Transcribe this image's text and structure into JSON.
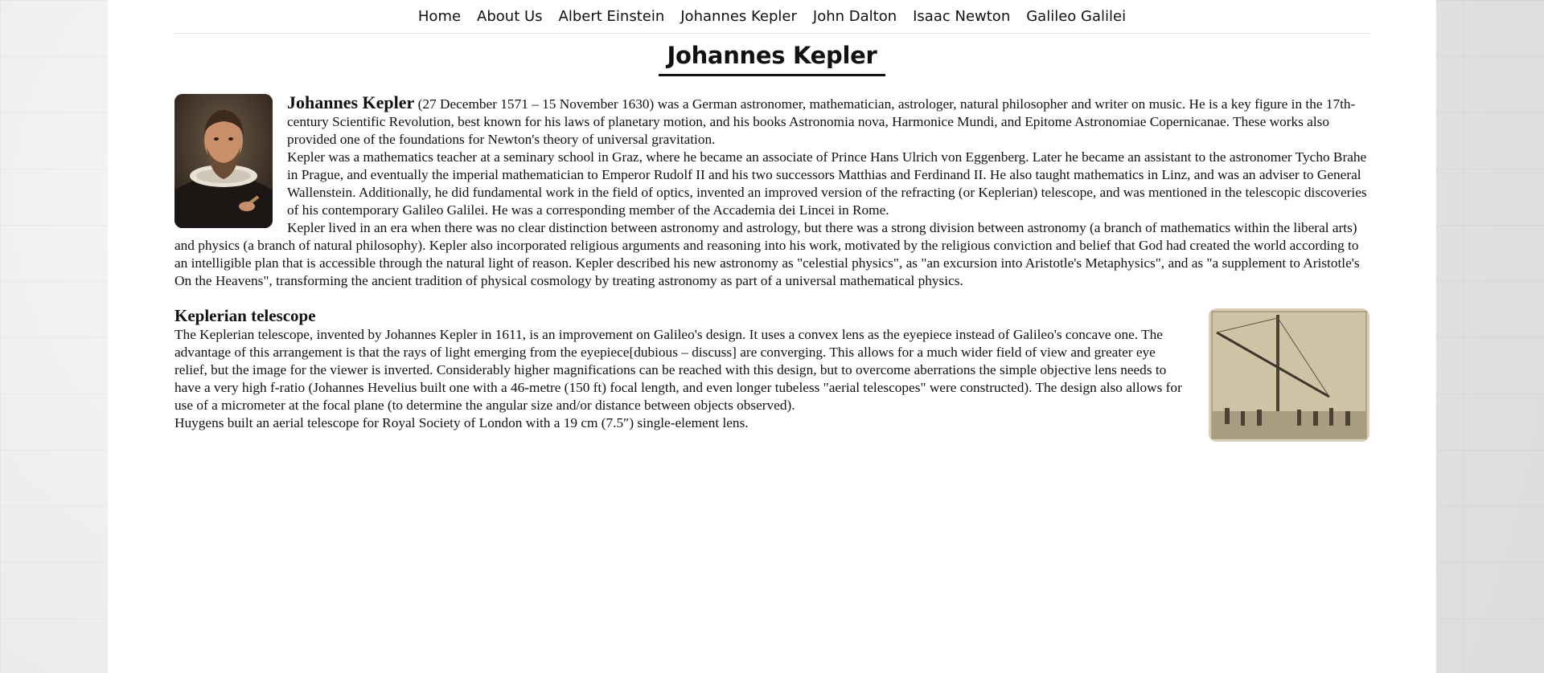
{
  "nav": {
    "items": [
      "Home",
      "About Us",
      "Albert Einstein",
      "Johannes Kepler",
      "John Dalton",
      "Isaac Newton",
      "Galileo Galilei"
    ]
  },
  "page": {
    "title": "Johannes Kepler"
  },
  "intro": {
    "lead_name": "Johannes Kepler",
    "lead_rest": " (27 December 1571 – 15 November 1630) was a German astronomer, mathematician, astrologer, natural philosopher and writer on music. He is a key figure in the 17th-century Scientific Revolution, best known for his laws of planetary motion, and his books Astronomia nova, Harmonice Mundi, and Epitome Astronomiae Copernicanae. These works also provided one of the foundations for Newton's theory of universal gravitation.",
    "p2": "Kepler was a mathematics teacher at a seminary school in Graz, where he became an associate of Prince Hans Ulrich von Eggenberg. Later he became an assistant to the astronomer Tycho Brahe in Prague, and eventually the imperial mathematician to Emperor Rudolf II and his two successors Matthias and Ferdinand II. He also taught mathematics in Linz, and was an adviser to General Wallenstein. Additionally, he did fundamental work in the field of optics, invented an improved version of the refracting (or Keplerian) telescope, and was mentioned in the telescopic discoveries of his contemporary Galileo Galilei. He was a corresponding member of the Accademia dei Lincei in Rome.",
    "p3": "Kepler lived in an era when there was no clear distinction between astronomy and astrology, but there was a strong division between astronomy (a branch of mathematics within the liberal arts) and physics (a branch of natural philosophy). Kepler also incorporated religious arguments and reasoning into his work, motivated by the religious conviction and belief that God had created the world according to an intelligible plan that is accessible through the natural light of reason. Kepler described his new astronomy as \"celestial physics\", as \"an excursion into Aristotle's Metaphysics\", and as \"a supplement to Aristotle's On the Heavens\", transforming the ancient tradition of physical cosmology by treating astronomy as part of a universal mathematical physics."
  },
  "telescope": {
    "heading": "Keplerian telescope",
    "p1": "The Keplerian telescope, invented by Johannes Kepler in 1611, is an improvement on Galileo's design. It uses a convex lens as the eyepiece instead of Galileo's concave one. The advantage of this arrangement is that the rays of light emerging from the eyepiece[dubious – discuss] are converging. This allows for a much wider field of view and greater eye relief, but the image for the viewer is inverted. Considerably higher magnifications can be reached with this design, but to overcome aberrations the simple objective lens needs to have a very high f-ratio (Johannes Hevelius built one with a 46-metre (150 ft) focal length, and even longer tubeless \"aerial telescopes\" were constructed). The design also allows for use of a micrometer at the focal plane (to determine the angular size and/or distance between objects observed).",
    "p2": "Huygens built an aerial telescope for Royal Society of London with a 19 cm (7.5″) single-element lens."
  }
}
